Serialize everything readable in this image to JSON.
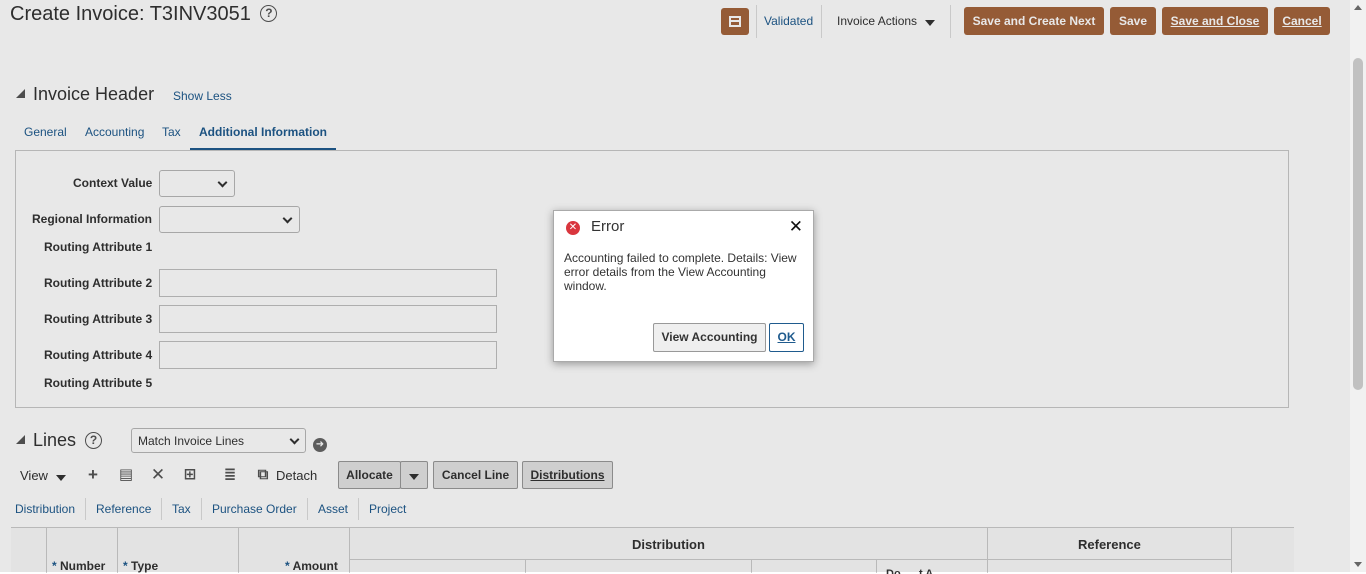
{
  "header": {
    "title": "Create Invoice: T3INV3051",
    "help": "?",
    "validated": "Validated",
    "invoice_actions": "Invoice Actions",
    "save_create_next": "Save and Create Next",
    "save": "Save",
    "save_close": "Save and Close",
    "cancel": "Cancel"
  },
  "invoice_header": {
    "title": "Invoice Header",
    "show_less": "Show Less",
    "tabs": [
      "General",
      "Accounting",
      "Tax",
      "Additional Information"
    ],
    "active_tab": "Additional Information",
    "fields": {
      "context_value": "Context Value",
      "regional_information": "Regional Information",
      "routing_1": "Routing Attribute 1",
      "routing_2": "Routing Attribute 2",
      "routing_3": "Routing Attribute 3",
      "routing_4": "Routing Attribute 4",
      "routing_5": "Routing Attribute 5"
    }
  },
  "lines": {
    "title": "Lines",
    "match_select": "Match Invoice Lines",
    "view": "View",
    "detach": "Detach",
    "allocate": "Allocate",
    "cancel_line": "Cancel Line",
    "distributions": "Distributions",
    "subtabs": [
      "Distribution",
      "Reference",
      "Tax",
      "Purchase Order",
      "Asset",
      "Project"
    ],
    "columns": {
      "number": "Number",
      "type": "Type",
      "amount": "Amount",
      "distribution": "Distribution",
      "reference": "Reference",
      "partial": "Do......t A......"
    },
    "required_mark": "*"
  },
  "dialog": {
    "title": "Error",
    "message": "Accounting failed to complete. Details: View error details from the View Accounting window.",
    "view_accounting": "View Accounting",
    "ok": "OK",
    "close": "✕"
  }
}
